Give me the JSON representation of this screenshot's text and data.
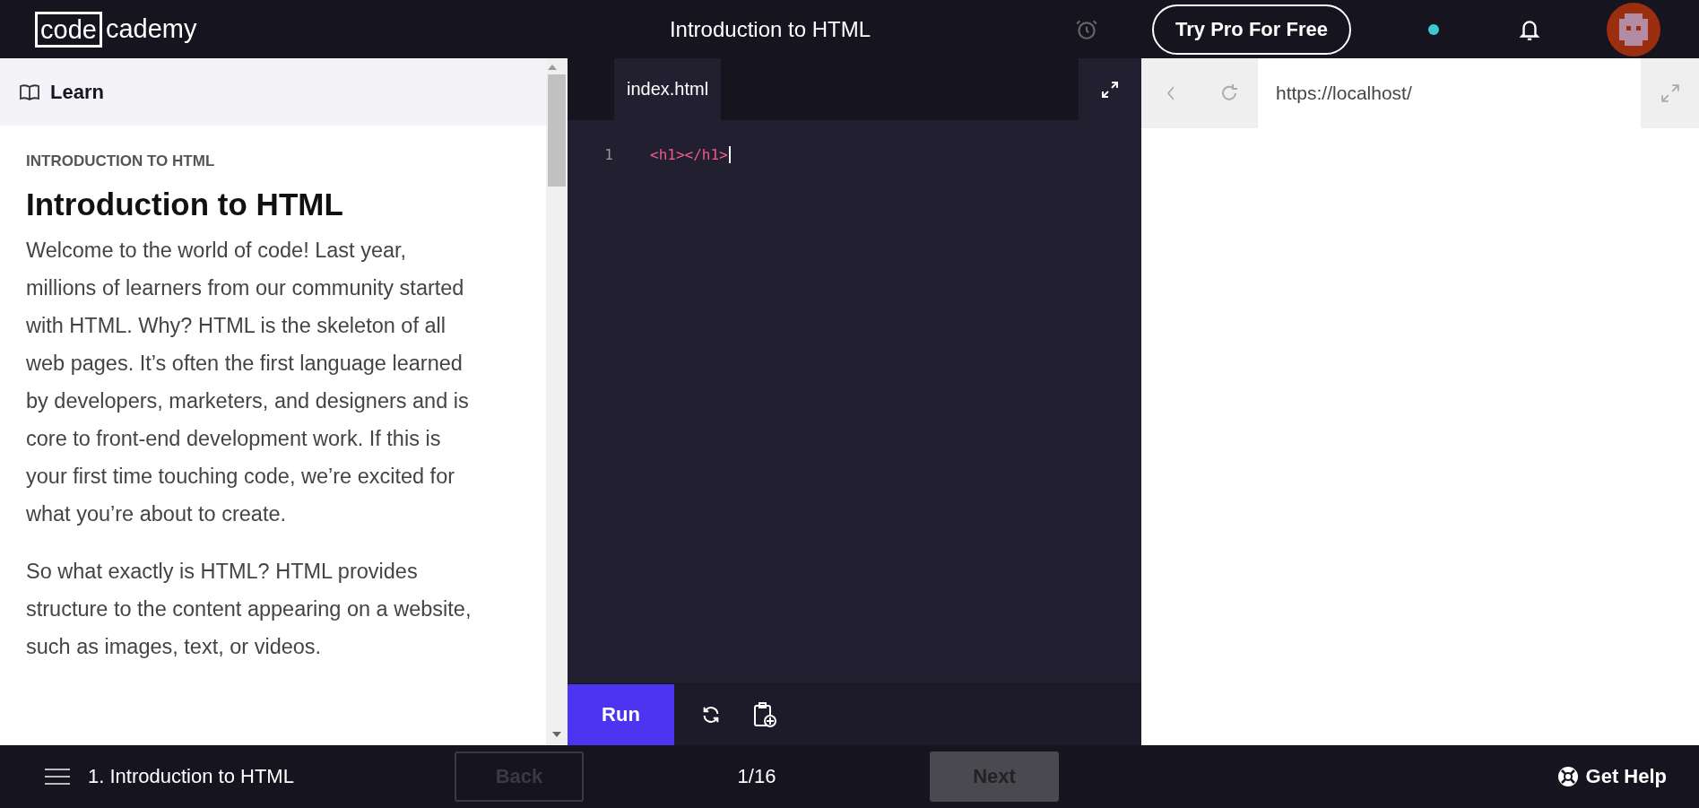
{
  "header": {
    "logo": [
      "code",
      "cademy"
    ],
    "title": "Introduction to HTML",
    "pro_button": "Try Pro For Free"
  },
  "learn": {
    "tab": "Learn",
    "eyebrow": "INTRODUCTION TO HTML",
    "title": "Introduction to HTML",
    "paragraphs": [
      "Welcome to the world of code! Last year, millions of learners from our community started with HTML. Why? HTML is the skeleton of all web pages. It’s often the first language learned by developers, marketers, and designers and is core to front-end development work. If this is your first time touching code, we’re excited for what you’re about to create.",
      "So what exactly is HTML? HTML provides structure to the content appearing on a website, such as images, text, or videos."
    ]
  },
  "editor": {
    "tabs": [
      {
        "label": "index.html",
        "selected": true
      }
    ],
    "lines": [
      {
        "number": "1",
        "code": "<h1></h1>"
      }
    ],
    "run": "Run"
  },
  "browser": {
    "url": "https://localhost/"
  },
  "footer": {
    "lesson": "1. Introduction to HTML",
    "back": {
      "label": "Back",
      "disabled": true
    },
    "progress": "1/16",
    "next": {
      "label": "Next",
      "disabled": true
    },
    "help": "Get Help"
  }
}
